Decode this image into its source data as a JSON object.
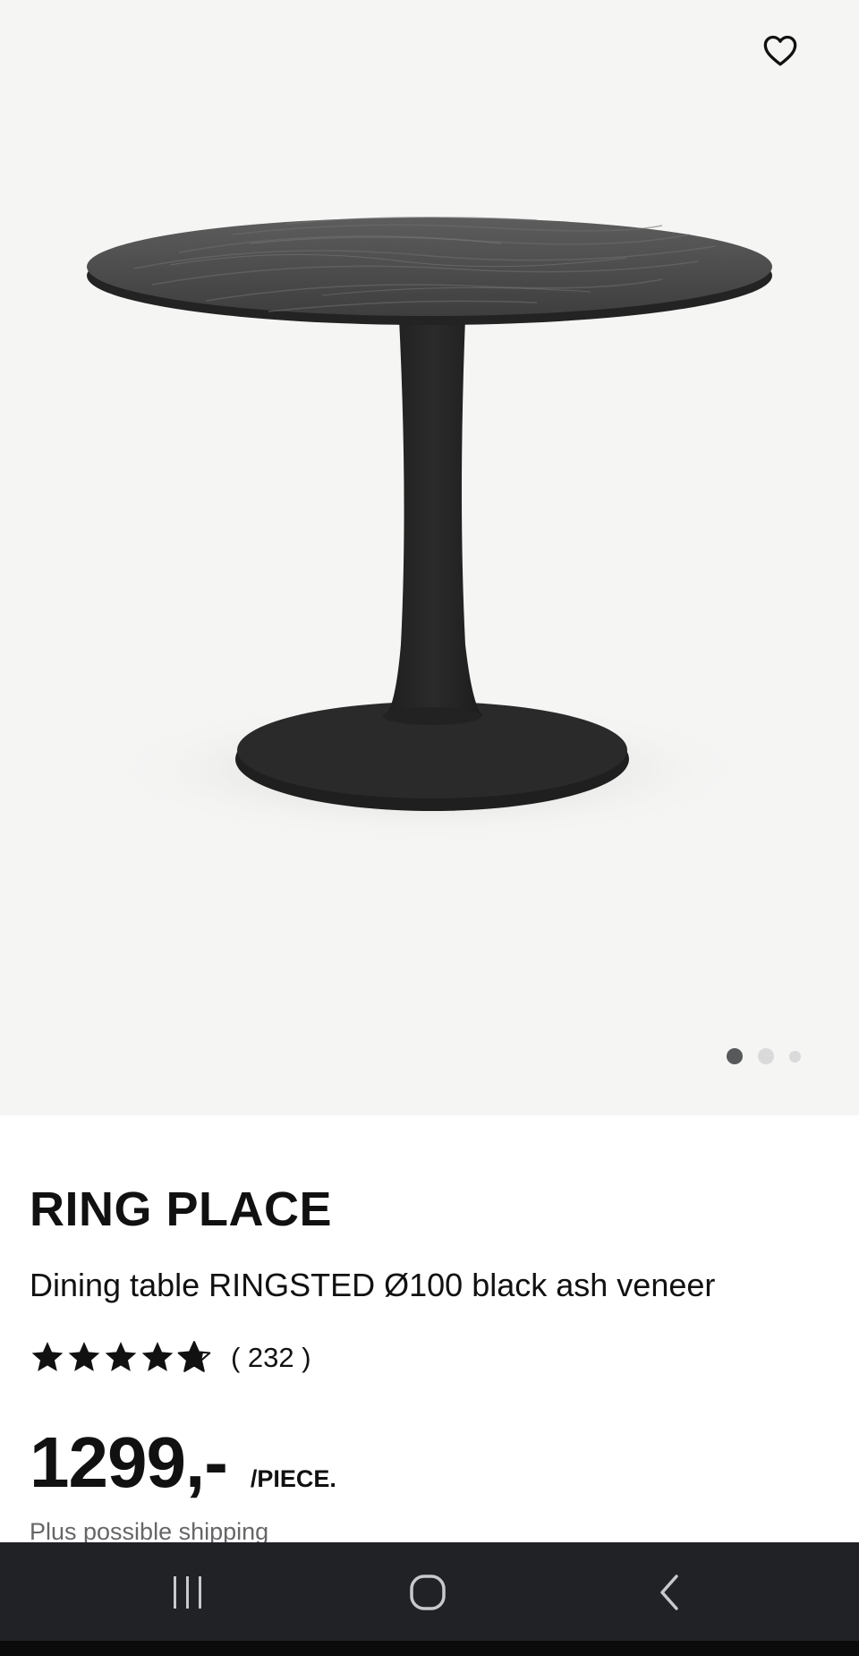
{
  "product": {
    "brand": "RING PLACE",
    "description": "Dining table RINGSTED Ø100 black ash veneer",
    "rating": 4.5,
    "rating_max": 5,
    "review_count": "( 232 )",
    "price": "1299,-",
    "unit": "/PIECE.",
    "shipping_note": "Plus possible shipping"
  },
  "gallery": {
    "image_count": 3,
    "active_index": 1
  },
  "icons": {
    "favorite": "heart-outline-icon",
    "star": "star-icon",
    "nav_recents": "recents-icon",
    "nav_home": "home-icon",
    "nav_back": "back-icon"
  },
  "colors": {
    "image_background": "#f5f5f4",
    "text": "#111111",
    "muted_text": "#666666",
    "active_dot": "#58595b",
    "inactive_dot": "#dadada",
    "navbar": "#212226"
  }
}
